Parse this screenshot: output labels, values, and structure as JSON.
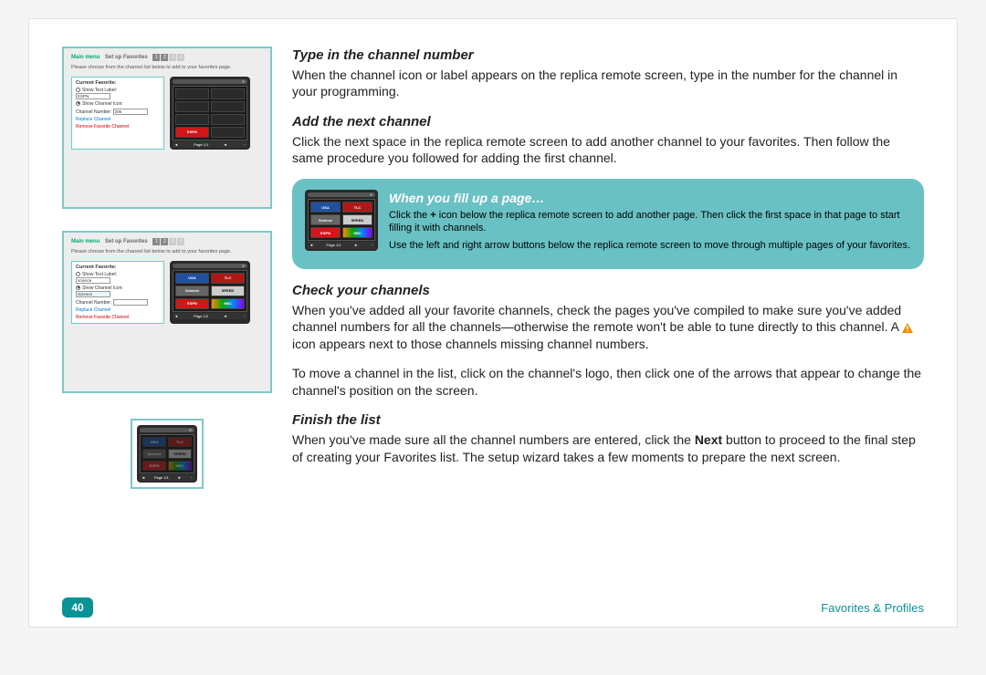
{
  "page_number": "40",
  "section_title": "Favorites & Profiles",
  "headings": {
    "h1": "Type in the channel number",
    "h2": "Add the next channel",
    "h3": "When you fill up a page…",
    "h4": "Check your channels",
    "h5": "Finish the list"
  },
  "body": {
    "p1": "When the channel icon or label appears on the replica remote screen, type in the number for the channel in your programming.",
    "p2": "Click the next space in the replica remote screen to add another channel to your favorites. Then follow the same procedure you followed for adding the first channel.",
    "callout_p1a": "Click the ",
    "callout_plus": "+",
    "callout_p1b": " icon below the replica remote screen to add another page. Then click the first space in that page to start filling it with channels.",
    "callout_p2": "Use the left and right arrow buttons below the replica remote screen to move through multiple pages of your favorites.",
    "p3a": "When you've added all your favorite channels, check the pages you've compiled to make sure you've added channel numbers for all the channels—otherwise the remote won't be able to tune directly to this channel. A ",
    "p3b": " icon appears next to those channels missing channel numbers.",
    "p4": "To move a channel in the list, click on the channel's logo, then click one of the arrows that appear to change the channel's position on the screen.",
    "p5a": "When you've made sure all the channel numbers are entered, click the ",
    "p5_next": "Next",
    "p5b": " button to proceed to the final step of creating your Favorites list. The setup wizard takes a few moments to prepare the next screen."
  },
  "thumbs": {
    "main_menu": "Main menu",
    "set_up": "Set up Favorites",
    "instr": "Please choose from the channel list below to add to your favorites page.",
    "current_favorite": "Current Favorite:",
    "show_text": "Show Text Label:",
    "show_icon": "Show Channel Icon:",
    "channel_number": "Channel Number:",
    "replace": "Replace Channel",
    "remove": "Remove Favorite Channel",
    "espn_text": "ESPN",
    "science_text": "science",
    "science_sel": "Science",
    "num206": "206",
    "page11": "Page 1/1",
    "page12": "Page 1/2",
    "arrow_l": "◄",
    "arrow_r": "►",
    "plus": "+",
    "ch_usa": "USA",
    "ch_tlc": "TLC",
    "ch_sci": "Science",
    "ch_spd": "SPEED",
    "ch_esp": "ESPN",
    "ch_nbc": "NBC"
  }
}
